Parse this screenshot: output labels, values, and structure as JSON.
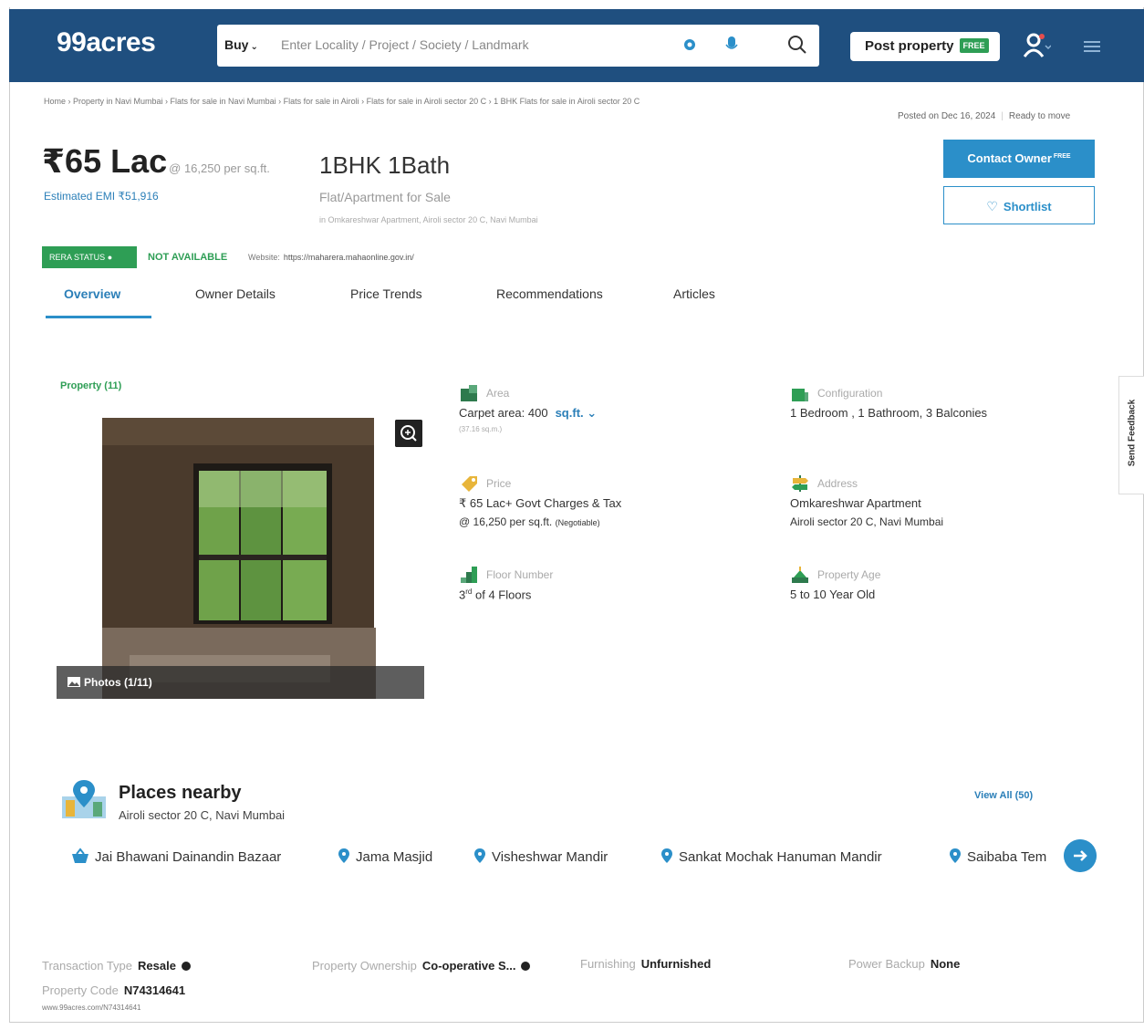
{
  "header": {
    "logo": "99acres",
    "search_mode": "Buy",
    "search_placeholder": "Enter Locality / Project / Society / Landmark",
    "post_property": "Post property",
    "post_badge": "FREE"
  },
  "breadcrumb": "Home › Property in Navi Mumbai › Flats for sale in Navi Mumbai › Flats for sale in Airoli › Flats for sale in Airoli sector 20 C › 1 BHK Flats for sale in Airoli sector 20 C",
  "posted": {
    "date": "Posted on Dec 16, 2024",
    "status": "Ready to move"
  },
  "listing": {
    "price": "₹65 Lac",
    "price_per_sqft": "@ 16,250 per sq.ft.",
    "emi": "Estimated EMI ₹51,916",
    "config": "1BHK 1Bath",
    "type": "Flat/Apartment for Sale",
    "location": "in Omkareshwar Apartment, Airoli sector 20 C, Navi Mumbai"
  },
  "actions": {
    "contact_owner": "Contact Owner",
    "contact_badge": "FREE",
    "shortlist": "Shortlist"
  },
  "rera": {
    "badge": "RERA STATUS",
    "status": "NOT AVAILABLE",
    "website_label": "Website:",
    "website_url": "https://maharera.mahaonline.gov.in/"
  },
  "tabs": [
    "Overview",
    "Owner Details",
    "Price Trends",
    "Recommendations",
    "Articles"
  ],
  "photos": {
    "count_label": "Property (11)",
    "caption": "Photos (1/11)"
  },
  "details": {
    "area": {
      "label": "Area",
      "value": "Carpet area: 400",
      "unit": "sq.ft.",
      "sub": "(37.16 sq.m.)"
    },
    "configuration": {
      "label": "Configuration",
      "value": "1 Bedroom , 1 Bathroom, 3 Balconies"
    },
    "price": {
      "label": "Price",
      "value": "₹ 65 Lac+ Govt Charges & Tax",
      "sub": "@ 16,250 per sq.ft.",
      "note": "(Negotiable)"
    },
    "address": {
      "label": "Address",
      "value": "Omkareshwar Apartment",
      "sub": "Airoli sector 20 C, Navi Mumbai"
    },
    "floor": {
      "label": "Floor Number",
      "floor": "3",
      "suffix": "rd",
      "value": "of 4 Floors"
    },
    "age": {
      "label": "Property Age",
      "value": "5 to 10 Year Old"
    }
  },
  "feedback": "Send Feedback",
  "places": {
    "title": "Places nearby",
    "subtitle": "Airoli sector 20 C, Navi Mumbai",
    "view_all": "View All (50)",
    "items": [
      "Jai Bhawani Dainandin Bazaar",
      "Jama Masjid",
      "Visheshwar Mandir",
      "Sankat Mochak Hanuman Mandir",
      "Saibaba Tem"
    ]
  },
  "facts": {
    "transaction": {
      "label": "Transaction Type",
      "value": "Resale"
    },
    "ownership": {
      "label": "Property Ownership",
      "value": "Co-operative S..."
    },
    "furnishing": {
      "label": "Furnishing",
      "value": "Unfurnished"
    },
    "power": {
      "label": "Power Backup",
      "value": "None"
    },
    "code": {
      "label": "Property Code",
      "value": "N74314641"
    },
    "url": "www.99acres.com/N74314641"
  },
  "colors": {
    "header": "#1f4f7f",
    "accent": "#2b8fc9",
    "green": "#2e9e55"
  }
}
